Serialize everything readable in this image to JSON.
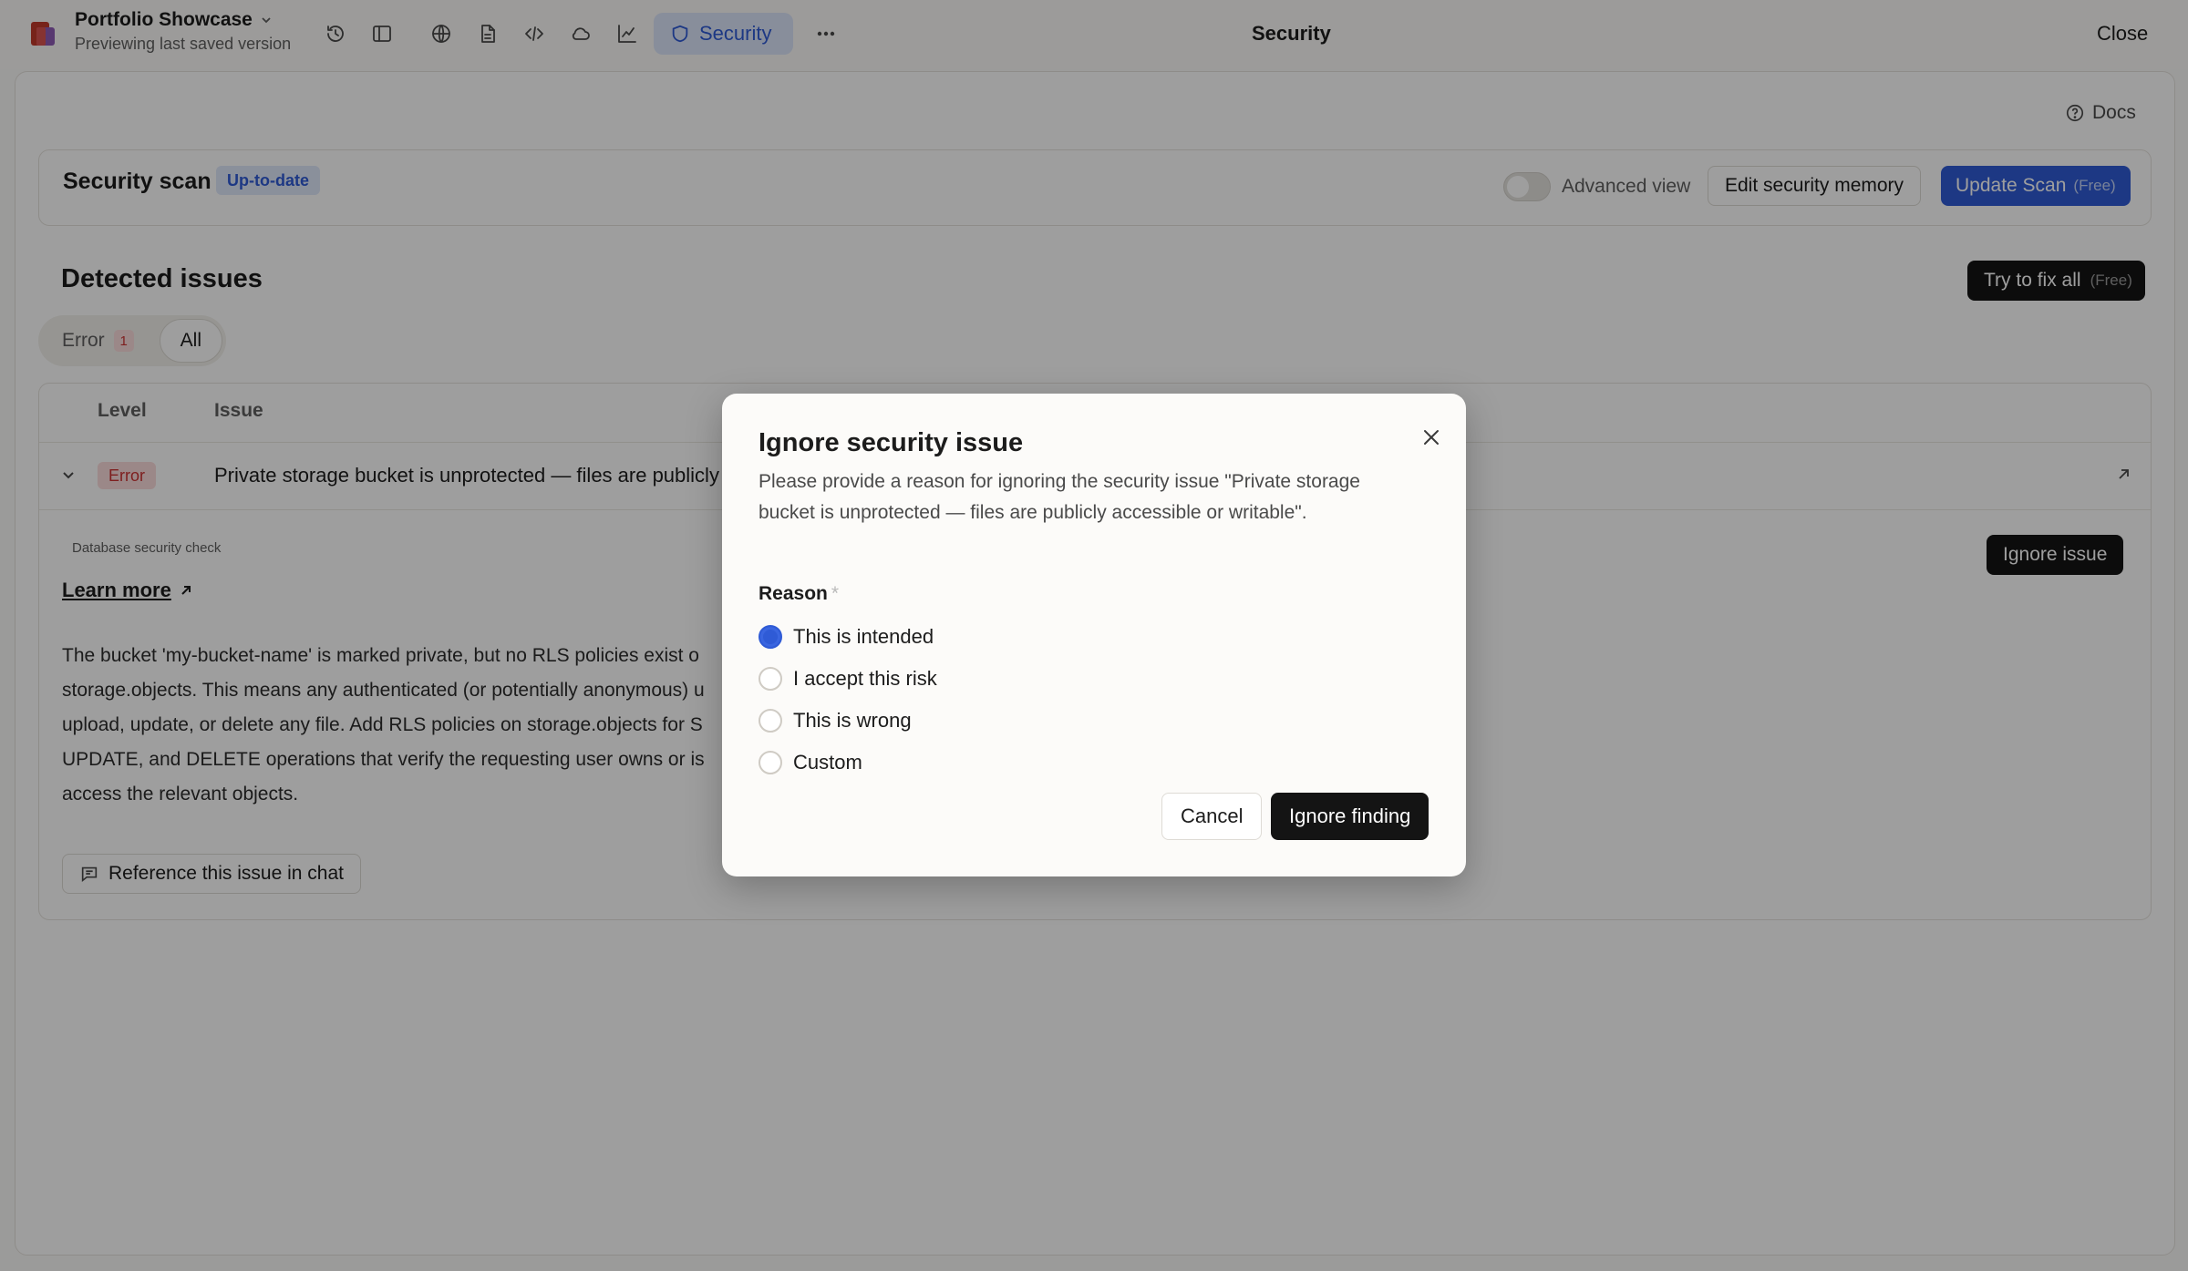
{
  "header": {
    "project_name": "Portfolio Showcase",
    "project_sub": "Previewing last saved version",
    "active_tab": "Security",
    "title": "Security",
    "close_label": "Close",
    "toolbar_icons": [
      "history-icon",
      "sidebar-icon",
      "globe-icon",
      "document-icon",
      "code-icon",
      "cloud-icon",
      "chart-icon",
      "more-icon"
    ]
  },
  "docs_label": "Docs",
  "scan": {
    "title": "Security scan",
    "status_badge": "Up-to-date",
    "advanced_view_label": "Advanced view",
    "edit_memory_label": "Edit security memory",
    "update_scan_label": "Update Scan",
    "update_scan_tag": "(Free)"
  },
  "issues": {
    "title": "Detected issues",
    "fix_all_label": "Try to fix all",
    "fix_all_tag": "(Free)",
    "filters": [
      {
        "label": "Error",
        "count": "1"
      },
      {
        "label": "All"
      }
    ],
    "columns": [
      "Level",
      "Issue"
    ],
    "rows": [
      {
        "level": "Error",
        "issue": "Private storage bucket is unprotected — files are publicly",
        "source": "Database security check",
        "learn_more": "Learn more",
        "ignore_label": "Ignore issue",
        "description_lines": [
          "The bucket 'my-bucket-name' is marked private, but no RLS policies exist o",
          "storage.objects. This means any authenticated (or potentially anonymous) u",
          "upload, update, or delete any file. Add RLS policies on storage.objects for S",
          "UPDATE, and DELETE operations that verify the requesting user owns or is",
          "access the relevant objects."
        ],
        "reference_label": "Reference this issue in chat"
      }
    ]
  },
  "modal": {
    "title": "Ignore security issue",
    "description": "Please provide a reason for ignoring the security issue \"Private storage bucket is unprotected — files are publicly accessible or writable\".",
    "reason_label": "Reason",
    "required_mark": "*",
    "options": [
      "This is intended",
      "I accept this risk",
      "This is wrong",
      "Custom"
    ],
    "selected_option": "This is intended",
    "cancel_label": "Cancel",
    "confirm_label": "Ignore finding"
  },
  "colors": {
    "accent": "#2f5bd6",
    "error": "#cc3333",
    "dark_button": "#141414"
  }
}
